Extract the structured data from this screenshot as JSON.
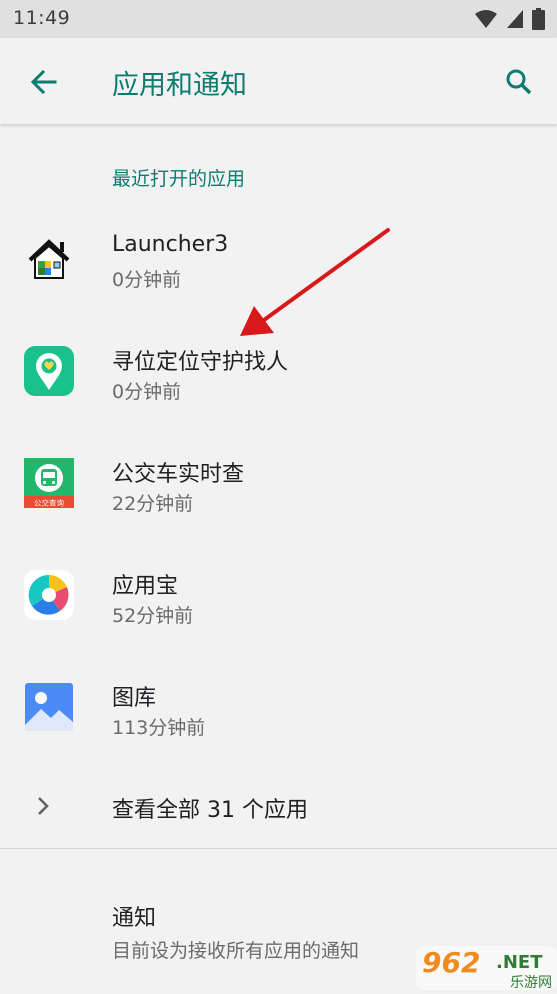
{
  "status_bar": {
    "time": "11:49",
    "icons": [
      "wifi-icon",
      "cellular-signal-icon",
      "battery-icon"
    ]
  },
  "app_bar": {
    "title": "应用和通知",
    "back_icon": "arrow-back-icon",
    "search_icon": "search-icon"
  },
  "recent_section": {
    "header": "最近打开的应用",
    "apps": [
      {
        "name": "Launcher3",
        "time": "0分钟前",
        "icon": "launcher-house-icon"
      },
      {
        "name": "寻位定位守护找人",
        "time": "0分钟前",
        "icon": "location-pin-icon"
      },
      {
        "name": "公交车实时查",
        "time": "22分钟前",
        "icon": "bus-icon",
        "icon_text": "公交查询"
      },
      {
        "name": "应用宝",
        "time": "52分钟前",
        "icon": "app-store-icon"
      },
      {
        "name": "图库",
        "time": "113分钟前",
        "icon": "gallery-icon"
      }
    ],
    "see_all": "查看全部 31 个应用"
  },
  "notifications": {
    "title": "通知",
    "summary": "目前设为接收所有应用的通知"
  },
  "watermark": {
    "number": "962",
    "suffix": ".NET",
    "text": "乐游网"
  },
  "colors": {
    "accent": "#0c7c70",
    "background": "#f2f2f2",
    "status_bar": "#e0e0e0",
    "annotation_arrow": "#d7191c"
  }
}
